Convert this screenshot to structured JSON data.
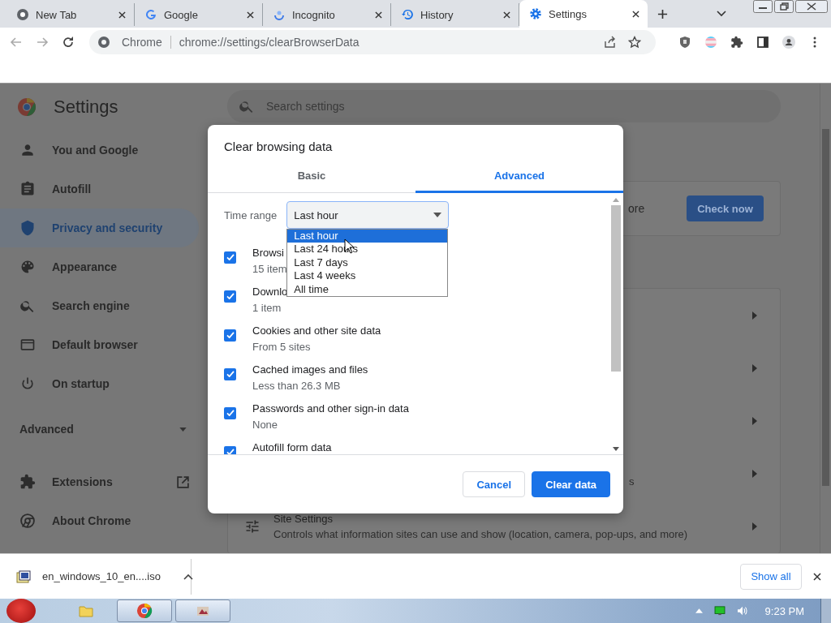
{
  "tabs": [
    {
      "title": "New Tab",
      "selected": false
    },
    {
      "title": "Google",
      "selected": false
    },
    {
      "title": "Incognito",
      "selected": false
    },
    {
      "title": "History",
      "selected": false
    },
    {
      "title": "Settings",
      "selected": true
    }
  ],
  "address_bar": {
    "site_label": "Chrome",
    "url": "chrome://settings/clearBrowserData"
  },
  "settings": {
    "title": "Settings",
    "search_placeholder": "Search settings",
    "nav": [
      {
        "label": "You and Google",
        "selected": false
      },
      {
        "label": "Autofill",
        "selected": false
      },
      {
        "label": "Privacy and security",
        "selected": true
      },
      {
        "label": "Appearance",
        "selected": false
      },
      {
        "label": "Search engine",
        "selected": false
      },
      {
        "label": "Default browser",
        "selected": false
      },
      {
        "label": "On startup",
        "selected": false
      }
    ],
    "advanced": {
      "label": "Advanced",
      "expanded": false
    },
    "nav_footer": [
      {
        "label": "Extensions",
        "external": true
      },
      {
        "label": "About Chrome",
        "external": false
      }
    ]
  },
  "main": {
    "safety_check": {
      "fragment": "ore",
      "button": "Check now"
    },
    "rows": [
      {
        "kind": "link"
      },
      {
        "kind": "link"
      },
      {
        "kind": "link"
      },
      {
        "kind": "link",
        "fragment": "s"
      },
      {
        "kind": "link",
        "title": "Site Settings",
        "description": "Controls what information sites can use and show (location, camera, pop-ups, and more)"
      }
    ]
  },
  "dialog": {
    "title": "Clear browsing data",
    "tabs": [
      {
        "label": "Basic",
        "selected": false
      },
      {
        "label": "Advanced",
        "selected": true
      }
    ],
    "time_range": {
      "label": "Time range",
      "value": "Last hour",
      "expanded": true,
      "options": [
        {
          "label": "Last hour",
          "selected": true
        },
        {
          "label": "Last 24 hours",
          "selected": false
        },
        {
          "label": "Last 7 days",
          "selected": false
        },
        {
          "label": "Last 4 weeks",
          "selected": false
        },
        {
          "label": "All time",
          "selected": false
        }
      ]
    },
    "items": [
      {
        "title": "Browsi",
        "detail": "15 item",
        "checked": true
      },
      {
        "title": "Downlo",
        "detail": "1 item",
        "checked": true
      },
      {
        "title": "Cookies and other site data",
        "detail": "From 5 sites",
        "checked": true
      },
      {
        "title": "Cached images and files",
        "detail": "Less than 26.3 MB",
        "checked": true
      },
      {
        "title": "Passwords and other sign-in data",
        "detail": "None",
        "checked": true
      },
      {
        "title": "Autofill form data",
        "checked": true
      }
    ],
    "buttons": [
      {
        "label": "Cancel",
        "kind": "secondary"
      },
      {
        "label": "Clear data",
        "kind": "primary"
      }
    ]
  },
  "download_bar": {
    "file": "en_windows_10_en....iso",
    "show_all": "Show all"
  },
  "taskbar": {
    "apps": [
      {
        "running": false
      },
      {
        "running": true
      },
      {
        "running": true
      }
    ],
    "clock": "9:23 PM"
  }
}
